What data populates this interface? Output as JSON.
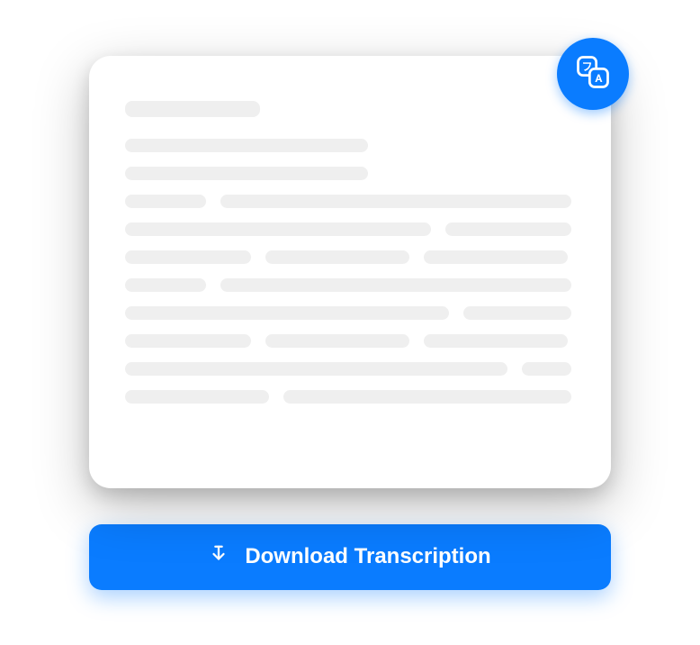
{
  "button": {
    "download_label": "Download Transcription"
  },
  "colors": {
    "primary": "#0a7cff",
    "skeleton": "#efefef"
  },
  "icons": {
    "translate": "translate-icon",
    "download": "download-icon"
  }
}
